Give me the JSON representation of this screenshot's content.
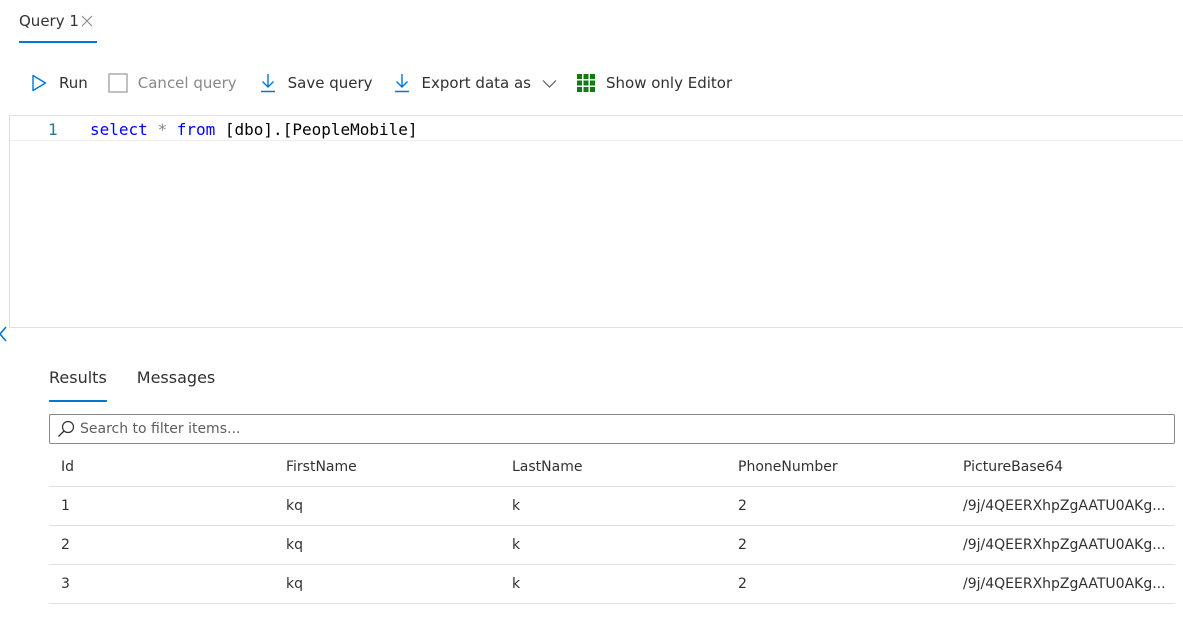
{
  "query_tab": {
    "label": "Query 1",
    "close_icon": "close-icon"
  },
  "toolbar": {
    "run_label": "Run",
    "run_icon": "play-icon",
    "cancel_label": "Cancel query",
    "cancel_icon": "checkbox-icon",
    "save_label": "Save query",
    "save_icon": "download-arrow-icon",
    "export_label": "Export data as",
    "export_icon": "download-arrow-icon",
    "export_chevron_icon": "chevron-down-icon",
    "editor_only_label": "Show only Editor",
    "editor_only_icon": "grid-icon",
    "accent_color": "#0078d4",
    "editor_icon_color": "#107c10"
  },
  "editor": {
    "line_number": "1",
    "tokens": {
      "kw_select": "select",
      "star": "*",
      "kw_from": "from",
      "table": "[dbo].[PeopleMobile]"
    }
  },
  "result_tabs": {
    "results": "Results",
    "messages": "Messages",
    "active": "Results"
  },
  "search": {
    "placeholder": "Search to filter items...",
    "value": ""
  },
  "grid": {
    "columns": [
      "Id",
      "FirstName",
      "LastName",
      "PhoneNumber",
      "PictureBase64"
    ],
    "rows": [
      [
        "1",
        "kq",
        "k",
        "2",
        "/9j/4QEERXhpZgAATU0AKg..."
      ],
      [
        "2",
        "kq",
        "k",
        "2",
        "/9j/4QEERXhpZgAATU0AKg..."
      ],
      [
        "3",
        "kq",
        "k",
        "2",
        "/9j/4QEERXhpZgAATU0AKg..."
      ]
    ]
  }
}
